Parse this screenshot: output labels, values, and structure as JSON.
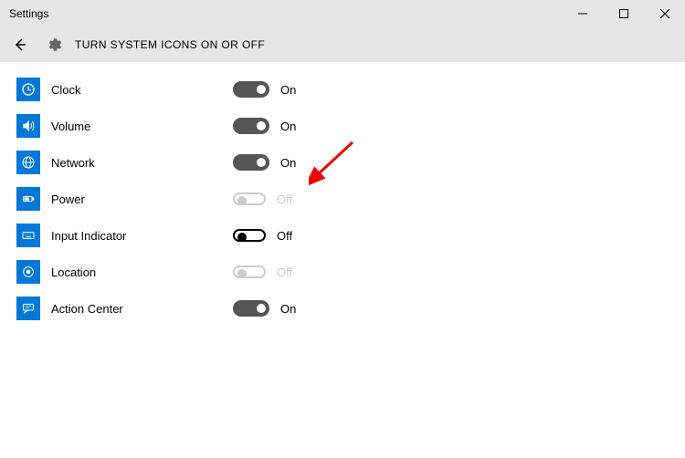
{
  "window": {
    "title": "Settings"
  },
  "page": {
    "title": "TURN SYSTEM ICONS ON OR OFF"
  },
  "labels": {
    "on": "On",
    "off": "Off"
  },
  "items": [
    {
      "icon": "clock-icon",
      "label": "Clock",
      "state": "on",
      "disabled": false
    },
    {
      "icon": "volume-icon",
      "label": "Volume",
      "state": "on",
      "disabled": false
    },
    {
      "icon": "network-icon",
      "label": "Network",
      "state": "on",
      "disabled": false
    },
    {
      "icon": "power-icon",
      "label": "Power",
      "state": "off",
      "disabled": true
    },
    {
      "icon": "keyboard-icon",
      "label": "Input Indicator",
      "state": "off",
      "disabled": false
    },
    {
      "icon": "location-icon",
      "label": "Location",
      "state": "off",
      "disabled": true
    },
    {
      "icon": "action-center-icon",
      "label": "Action Center",
      "state": "on",
      "disabled": false
    }
  ]
}
